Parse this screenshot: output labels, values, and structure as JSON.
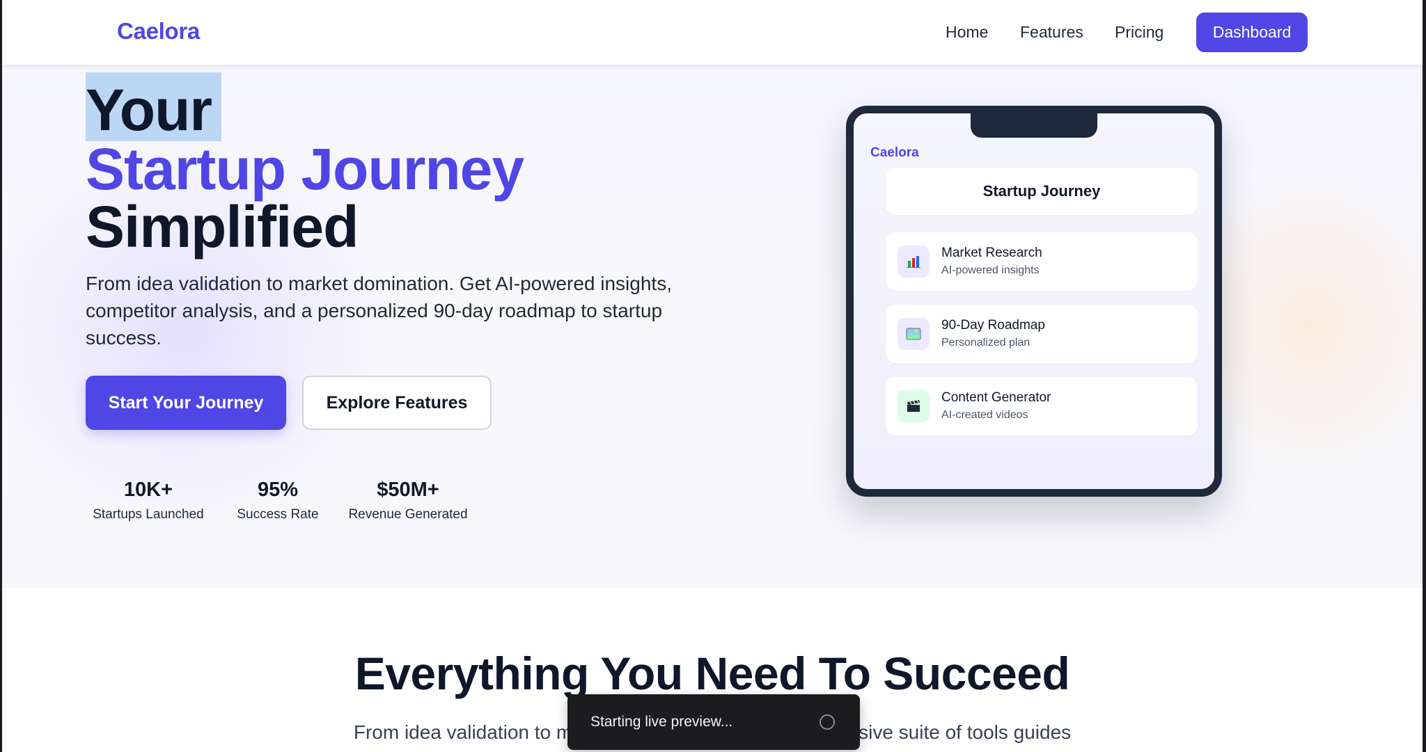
{
  "nav": {
    "logo": "Caelora",
    "links": [
      {
        "label": "Home"
      },
      {
        "label": "Features"
      },
      {
        "label": "Pricing"
      }
    ],
    "cta_label": "Dashboard"
  },
  "hero": {
    "title_line1": "Your",
    "title_line2": "Startup Journey",
    "title_line3": "Simplified",
    "description": "From idea validation to market domination. Get AI-powered insights, competitor analysis, and a personalized 90-day roadmap to startup success.",
    "primary_button": "Start Your Journey",
    "secondary_button": "Explore Features",
    "stats": [
      {
        "value": "10K+",
        "label": "Startups Launched"
      },
      {
        "value": "95%",
        "label": "Success Rate"
      },
      {
        "value": "$50M+",
        "label": "Revenue Generated"
      }
    ]
  },
  "device": {
    "logo": "Caelora",
    "title": "Startup Journey",
    "features": [
      {
        "title": "Market Research",
        "subtitle": "AI-powered insights",
        "icon": "bar-chart-icon"
      },
      {
        "title": "90-Day Roadmap",
        "subtitle": "Personalized plan",
        "icon": "map-icon"
      },
      {
        "title": "Content Generator",
        "subtitle": "AI-created videos",
        "icon": "clapperboard-icon"
      }
    ]
  },
  "section": {
    "title": "Everything You Need To Succeed",
    "subtitle": "From idea validation to market domination, our comprehensive suite of tools guides"
  },
  "toast": {
    "text": "Starting live preview..."
  },
  "colors": {
    "accent": "#4f46e5",
    "heading": "#0f172a",
    "device_frame": "#1e293b"
  }
}
